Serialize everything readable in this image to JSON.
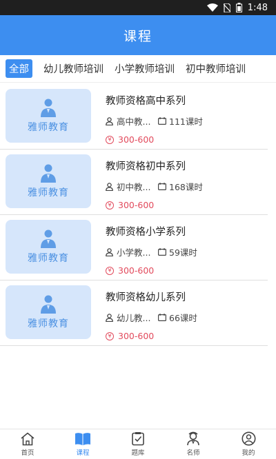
{
  "status_bar": {
    "time": "1:48"
  },
  "header": {
    "title": "课程"
  },
  "tabs": [
    {
      "label": "全部",
      "active": true
    },
    {
      "label": "幼儿教师培训",
      "active": false
    },
    {
      "label": "小学教师培训",
      "active": false
    },
    {
      "label": "初中教师培训",
      "active": false
    }
  ],
  "courses": [
    {
      "thumb_brand": "雅师教育",
      "title": "教师资格高中系列",
      "level": "高中教...",
      "hours": "111课时",
      "price": "300-600"
    },
    {
      "thumb_brand": "雅师教育",
      "title": "教师资格初中系列",
      "level": "初中教...",
      "hours": "168课时",
      "price": "300-600"
    },
    {
      "thumb_brand": "雅师教育",
      "title": "教师资格小学系列",
      "level": "小学教...",
      "hours": "59课时",
      "price": "300-600"
    },
    {
      "thumb_brand": "雅师教育",
      "title": "教师资格幼儿系列",
      "level": "幼儿教...",
      "hours": "66课时",
      "price": "300-600"
    }
  ],
  "price_symbol": "¥",
  "bottom_nav": [
    {
      "label": "首页",
      "icon": "home-icon",
      "active": false
    },
    {
      "label": "课程",
      "icon": "book-icon",
      "active": true
    },
    {
      "label": "题库",
      "icon": "question-bank-icon",
      "active": false
    },
    {
      "label": "名师",
      "icon": "teacher-icon",
      "active": false
    },
    {
      "label": "我的",
      "icon": "profile-icon",
      "active": false
    }
  ],
  "colors": {
    "accent": "#3d8ef0",
    "price": "#e24a5c",
    "thumb_bg": "#d6e6fb"
  }
}
